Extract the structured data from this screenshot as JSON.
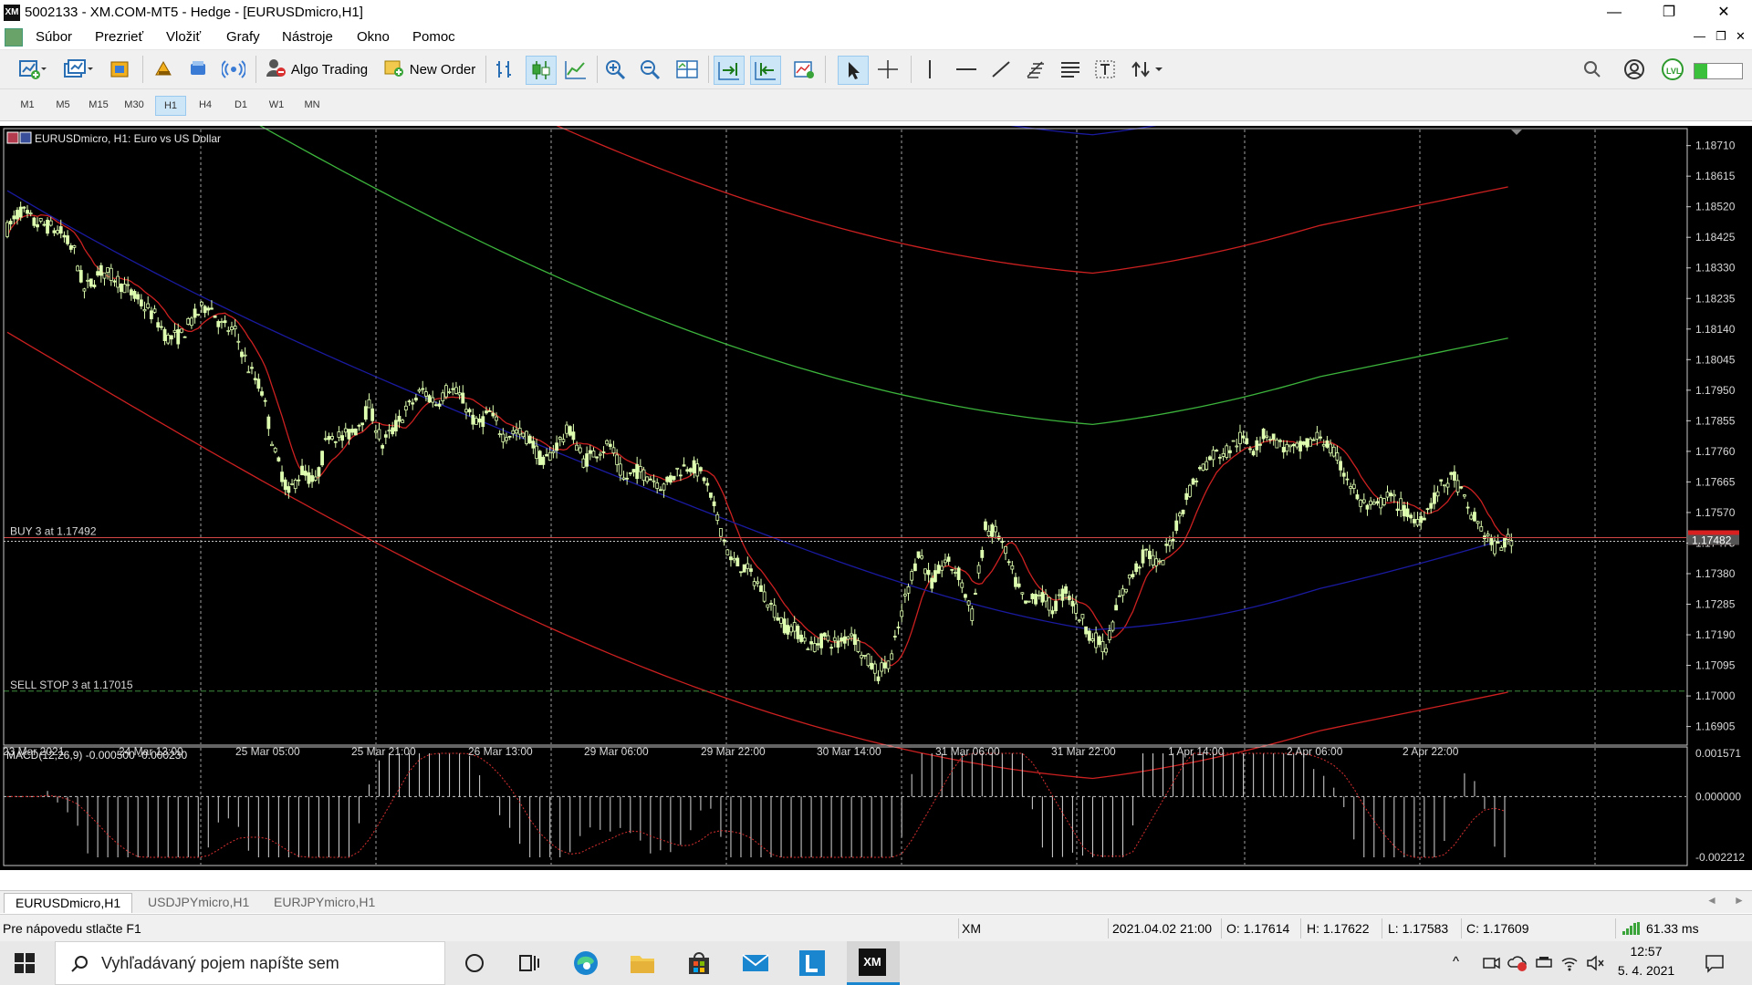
{
  "window": {
    "title": "5002133 - XM.COM-MT5 - Hedge - [EURUSDmicro,H1]",
    "app_logo": "XM",
    "controls": [
      "—",
      "❐",
      "✕"
    ]
  },
  "menu": {
    "items": [
      "Súbor",
      "Prezrieť",
      "Vložiť",
      "Grafy",
      "Nástroje",
      "Okno",
      "Pomoc"
    ],
    "mdi_controls": [
      "—",
      "❐",
      "✕"
    ]
  },
  "toolbar": {
    "algo_trading": "Algo Trading",
    "new_order": "New Order"
  },
  "timeframes": {
    "items": [
      "M1",
      "M5",
      "M15",
      "M30",
      "H1",
      "H4",
      "D1",
      "W1",
      "MN"
    ],
    "active": "H1"
  },
  "chart": {
    "header": "EURUSDmicro, H1:  Euro vs US Dollar",
    "buy_label": "BUY 3 at 1.17492",
    "sell_label": "SELL STOP 3 at 1.17015",
    "current_price": "1.17482",
    "price_ticks": [
      "1.18710",
      "1.18615",
      "1.18520",
      "1.18425",
      "1.18330",
      "1.18235",
      "1.18140",
      "1.18045",
      "1.17950",
      "1.17855",
      "1.17760",
      "1.17665",
      "1.17570",
      "1.17475",
      "1.17380",
      "1.17285",
      "1.17190",
      "1.17095",
      "1.17000",
      "1.16905"
    ],
    "time_ticks": [
      "23 Mar 2021",
      "24 Mar 13:00",
      "25 Mar 05:00",
      "25 Mar 21:00",
      "26 Mar 13:00",
      "29 Mar 06:00",
      "29 Mar 22:00",
      "30 Mar 14:00",
      "31 Mar 06:00",
      "31 Mar 22:00",
      "1 Apr 14:00",
      "2 Apr 06:00",
      "2 Apr 22:00"
    ],
    "macd_label": "MACD(12,26,9) -0.000500 -0.000230",
    "macd_ticks": [
      "0.001571",
      "0.000000",
      "-0.002212"
    ]
  },
  "chart_data": {
    "type": "candlestick",
    "symbol": "EURUSDmicro",
    "timeframe": "H1",
    "ylim": [
      1.1685,
      1.1876
    ],
    "path_points": [
      [
        0,
        1.1845
      ],
      [
        4,
        1.1851
      ],
      [
        8,
        1.1847
      ],
      [
        12,
        1.1846
      ],
      [
        16,
        1.1844
      ],
      [
        20,
        1.1838
      ],
      [
        23,
        1.1826
      ],
      [
        28,
        1.1832
      ],
      [
        32,
        1.183
      ],
      [
        36,
        1.1826
      ],
      [
        40,
        1.1822
      ],
      [
        44,
        1.1818
      ],
      [
        48,
        1.1811
      ],
      [
        52,
        1.1812
      ],
      [
        56,
        1.1818
      ],
      [
        60,
        1.1822
      ],
      [
        64,
        1.1815
      ],
      [
        68,
        1.1813
      ],
      [
        72,
        1.1802
      ],
      [
        76,
        1.1795
      ],
      [
        80,
        1.1775
      ],
      [
        84,
        1.1763
      ],
      [
        88,
        1.177
      ],
      [
        92,
        1.1766
      ],
      [
        96,
        1.1782
      ],
      [
        100,
        1.178
      ],
      [
        104,
        1.1783
      ],
      [
        108,
        1.179
      ],
      [
        112,
        1.1778
      ],
      [
        116,
        1.1784
      ],
      [
        120,
        1.179
      ],
      [
        124,
        1.1795
      ],
      [
        128,
        1.1791
      ],
      [
        132,
        1.1796
      ],
      [
        136,
        1.1792
      ],
      [
        140,
        1.1784
      ],
      [
        144,
        1.1788
      ],
      [
        148,
        1.1781
      ],
      [
        152,
        1.1782
      ],
      [
        156,
        1.178
      ],
      [
        160,
        1.1772
      ],
      [
        164,
        1.1778
      ],
      [
        168,
        1.1783
      ],
      [
        172,
        1.1773
      ],
      [
        176,
        1.1776
      ],
      [
        180,
        1.1778
      ],
      [
        184,
        1.1767
      ],
      [
        188,
        1.177
      ],
      [
        192,
        1.1768
      ],
      [
        196,
        1.1765
      ],
      [
        200,
        1.177
      ],
      [
        204,
        1.1772
      ],
      [
        208,
        1.1768
      ],
      [
        212,
        1.1755
      ],
      [
        216,
        1.1742
      ],
      [
        220,
        1.174
      ],
      [
        224,
        1.1735
      ],
      [
        228,
        1.1728
      ],
      [
        232,
        1.1722
      ],
      [
        236,
        1.172
      ],
      [
        240,
        1.1715
      ],
      [
        244,
        1.1718
      ],
      [
        248,
        1.1716
      ],
      [
        252,
        1.172
      ],
      [
        256,
        1.1712
      ],
      [
        260,
        1.1707
      ],
      [
        264,
        1.1712
      ],
      [
        268,
        1.173
      ],
      [
        272,
        1.1745
      ],
      [
        276,
        1.1735
      ],
      [
        280,
        1.1742
      ],
      [
        284,
        1.1738
      ],
      [
        288,
        1.1725
      ],
      [
        292,
        1.1752
      ],
      [
        296,
        1.175
      ],
      [
        300,
        1.1738
      ],
      [
        304,
        1.1728
      ],
      [
        308,
        1.1732
      ],
      [
        312,
        1.1727
      ],
      [
        316,
        1.1733
      ],
      [
        320,
        1.1725
      ],
      [
        324,
        1.1718
      ],
      [
        328,
        1.1715
      ],
      [
        332,
        1.173
      ],
      [
        336,
        1.1738
      ],
      [
        340,
        1.1745
      ],
      [
        344,
        1.174
      ],
      [
        348,
        1.175
      ],
      [
        352,
        1.1762
      ],
      [
        356,
        1.177
      ],
      [
        360,
        1.1775
      ],
      [
        364,
        1.1776
      ],
      [
        368,
        1.178
      ],
      [
        372,
        1.1777
      ],
      [
        376,
        1.1782
      ],
      [
        380,
        1.1778
      ],
      [
        384,
        1.1776
      ],
      [
        388,
        1.1778
      ],
      [
        392,
        1.1781
      ],
      [
        396,
        1.1775
      ],
      [
        400,
        1.1768
      ],
      [
        404,
        1.176
      ],
      [
        408,
        1.1758
      ],
      [
        412,
        1.1762
      ],
      [
        416,
        1.1759
      ],
      [
        420,
        1.1754
      ],
      [
        424,
        1.1758
      ],
      [
        428,
        1.1765
      ],
      [
        432,
        1.1768
      ],
      [
        436,
        1.1758
      ],
      [
        440,
        1.1752
      ],
      [
        444,
        1.1746
      ],
      [
        448,
        1.1748
      ]
    ],
    "series": [
      {
        "name": "BUY 3 at 1.17492",
        "values": [
          1.17492
        ]
      },
      {
        "name": "SELL STOP 3 at 1.17015",
        "values": [
          1.17015
        ]
      }
    ],
    "indicator": "MACD(12,26,9)",
    "macd_values": [
      -0.0005,
      -0.00023
    ],
    "macd_ylim": [
      -0.002212,
      0.001571
    ],
    "grid": "on"
  },
  "tabs": {
    "items": [
      "EURUSDmicro,H1",
      "USDJPYmicro,H1",
      "EURJPYmicro,H1"
    ],
    "active": "EURUSDmicro,H1"
  },
  "status": {
    "help": "Pre nápovedu stlačte F1",
    "profile": "XM",
    "datetime": "2021.04.02 21:00",
    "open": "O: 1.17614",
    "high": "H: 1.17622",
    "low": "L: 1.17583",
    "close": "C: 1.17609",
    "ping": "61.33 ms"
  },
  "taskbar": {
    "search_placeholder": "Vyhľadávaný pojem napíšte sem",
    "time": "12:57",
    "date": "5. 4. 2021"
  },
  "colors": {
    "bull_candle": "#dfffb0",
    "red_line": "#cc2020",
    "green_line": "#3cb43c",
    "blue_line": "#1a1aa0",
    "grid": "#c8c8c8",
    "buy_line": "#d24646",
    "sell_line": "#3c8c3c"
  }
}
